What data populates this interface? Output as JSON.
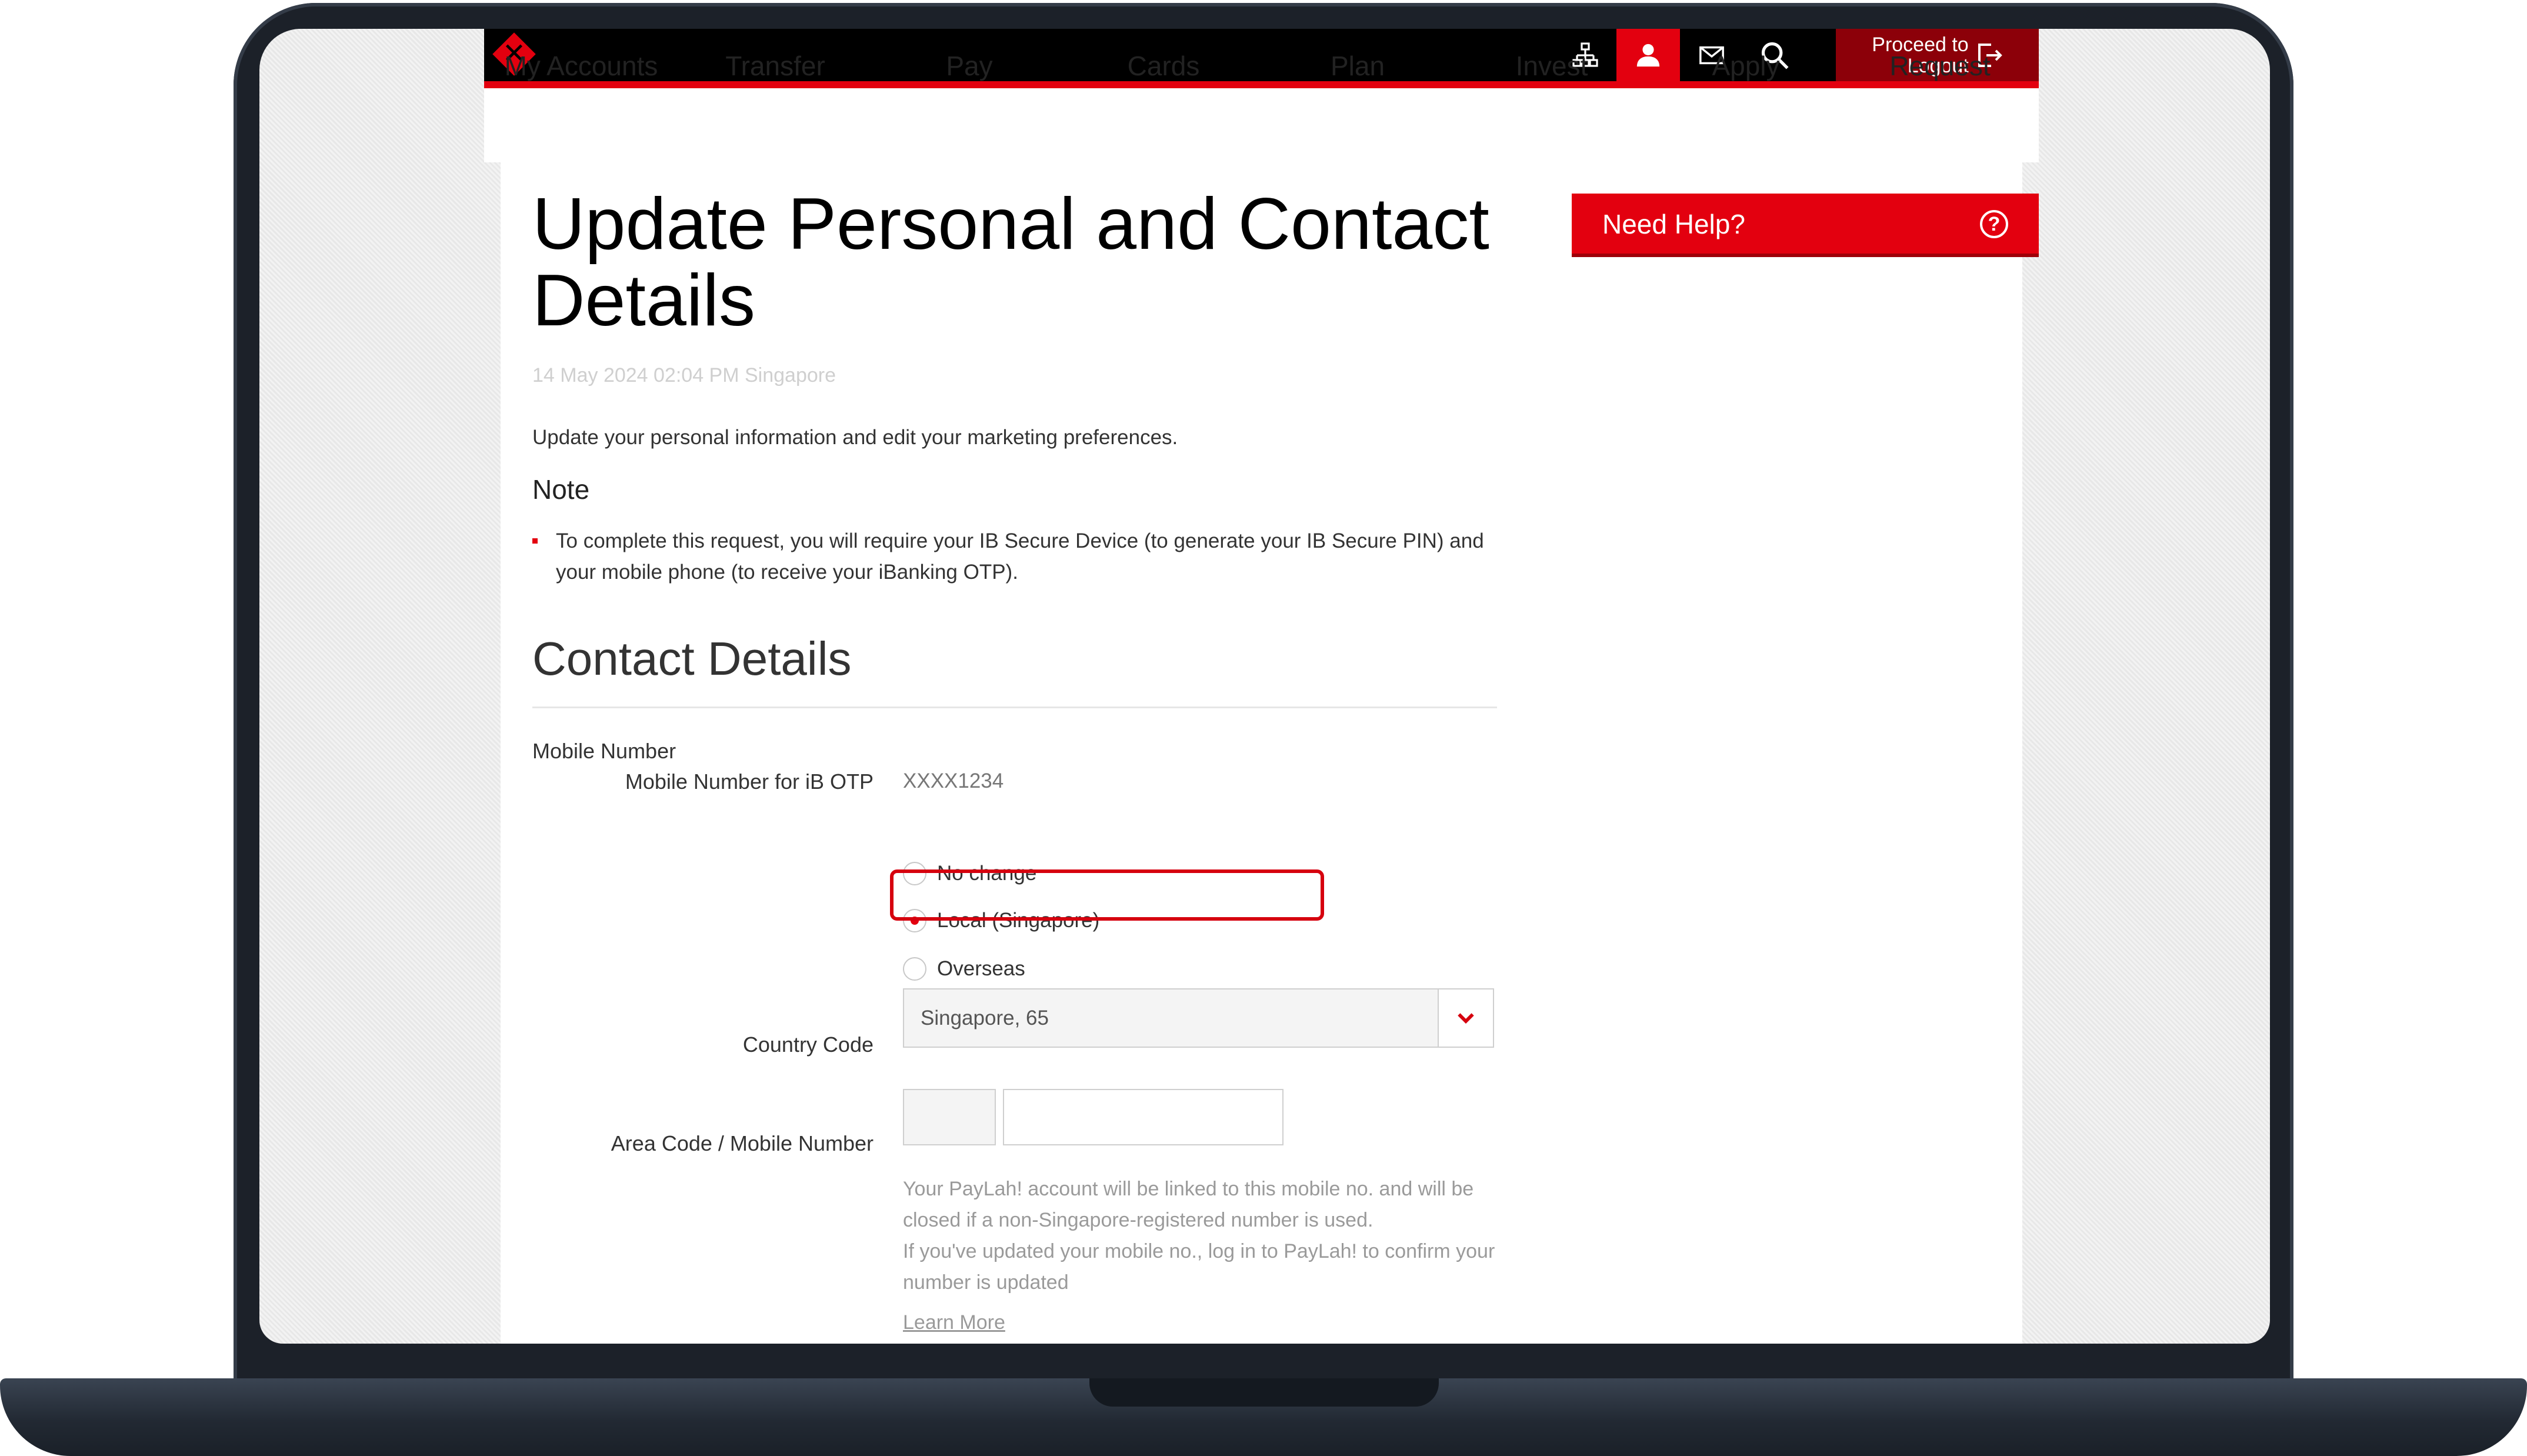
{
  "header": {
    "logout_label_line1": "Proceed to",
    "logout_label_line2": "Logout",
    "icons": [
      "sitemap-icon",
      "profile-icon",
      "mail-icon",
      "search-icon",
      "logout-icon"
    ],
    "brand_color": "#e3000f"
  },
  "nav": {
    "items": [
      "My Accounts",
      "Transfer",
      "Pay",
      "Cards",
      "Plan",
      "Invest",
      "Apply",
      "Request"
    ]
  },
  "page": {
    "title": "Update Personal and Contact Details",
    "timestamp": "14 May 2024 02:04 PM Singapore",
    "intro": "Update your personal information and edit your marketing preferences.",
    "note_title": "Note",
    "note_bullet": "To complete this request, you will require your IB Secure Device (to generate your IB Secure PIN) and your mobile phone (to receive your iBanking OTP).",
    "section_title": "Contact Details"
  },
  "form": {
    "mobile_number_label": "Mobile Number",
    "otp_label": "Mobile Number for iB OTP",
    "otp_value": "XXXX1234",
    "radio_options": [
      {
        "label": "No change",
        "checked": false
      },
      {
        "label": "Local (Singapore)",
        "checked": true
      },
      {
        "label": "Overseas",
        "checked": false
      }
    ],
    "country_code_label": "Country Code",
    "country_code_value": "Singapore, 65",
    "area_mobile_label": "Area Code / Mobile Number",
    "help_line1": "Your PayLah! account will be linked to this mobile no. and will be closed if a non-Singapore-registered number is used.",
    "help_line2": "If you've updated your mobile no., log in to PayLah! to confirm your number is updated",
    "learn_more": "Learn More"
  },
  "sidebar": {
    "need_help": "Need Help?",
    "help_icon_glyph": "?"
  }
}
